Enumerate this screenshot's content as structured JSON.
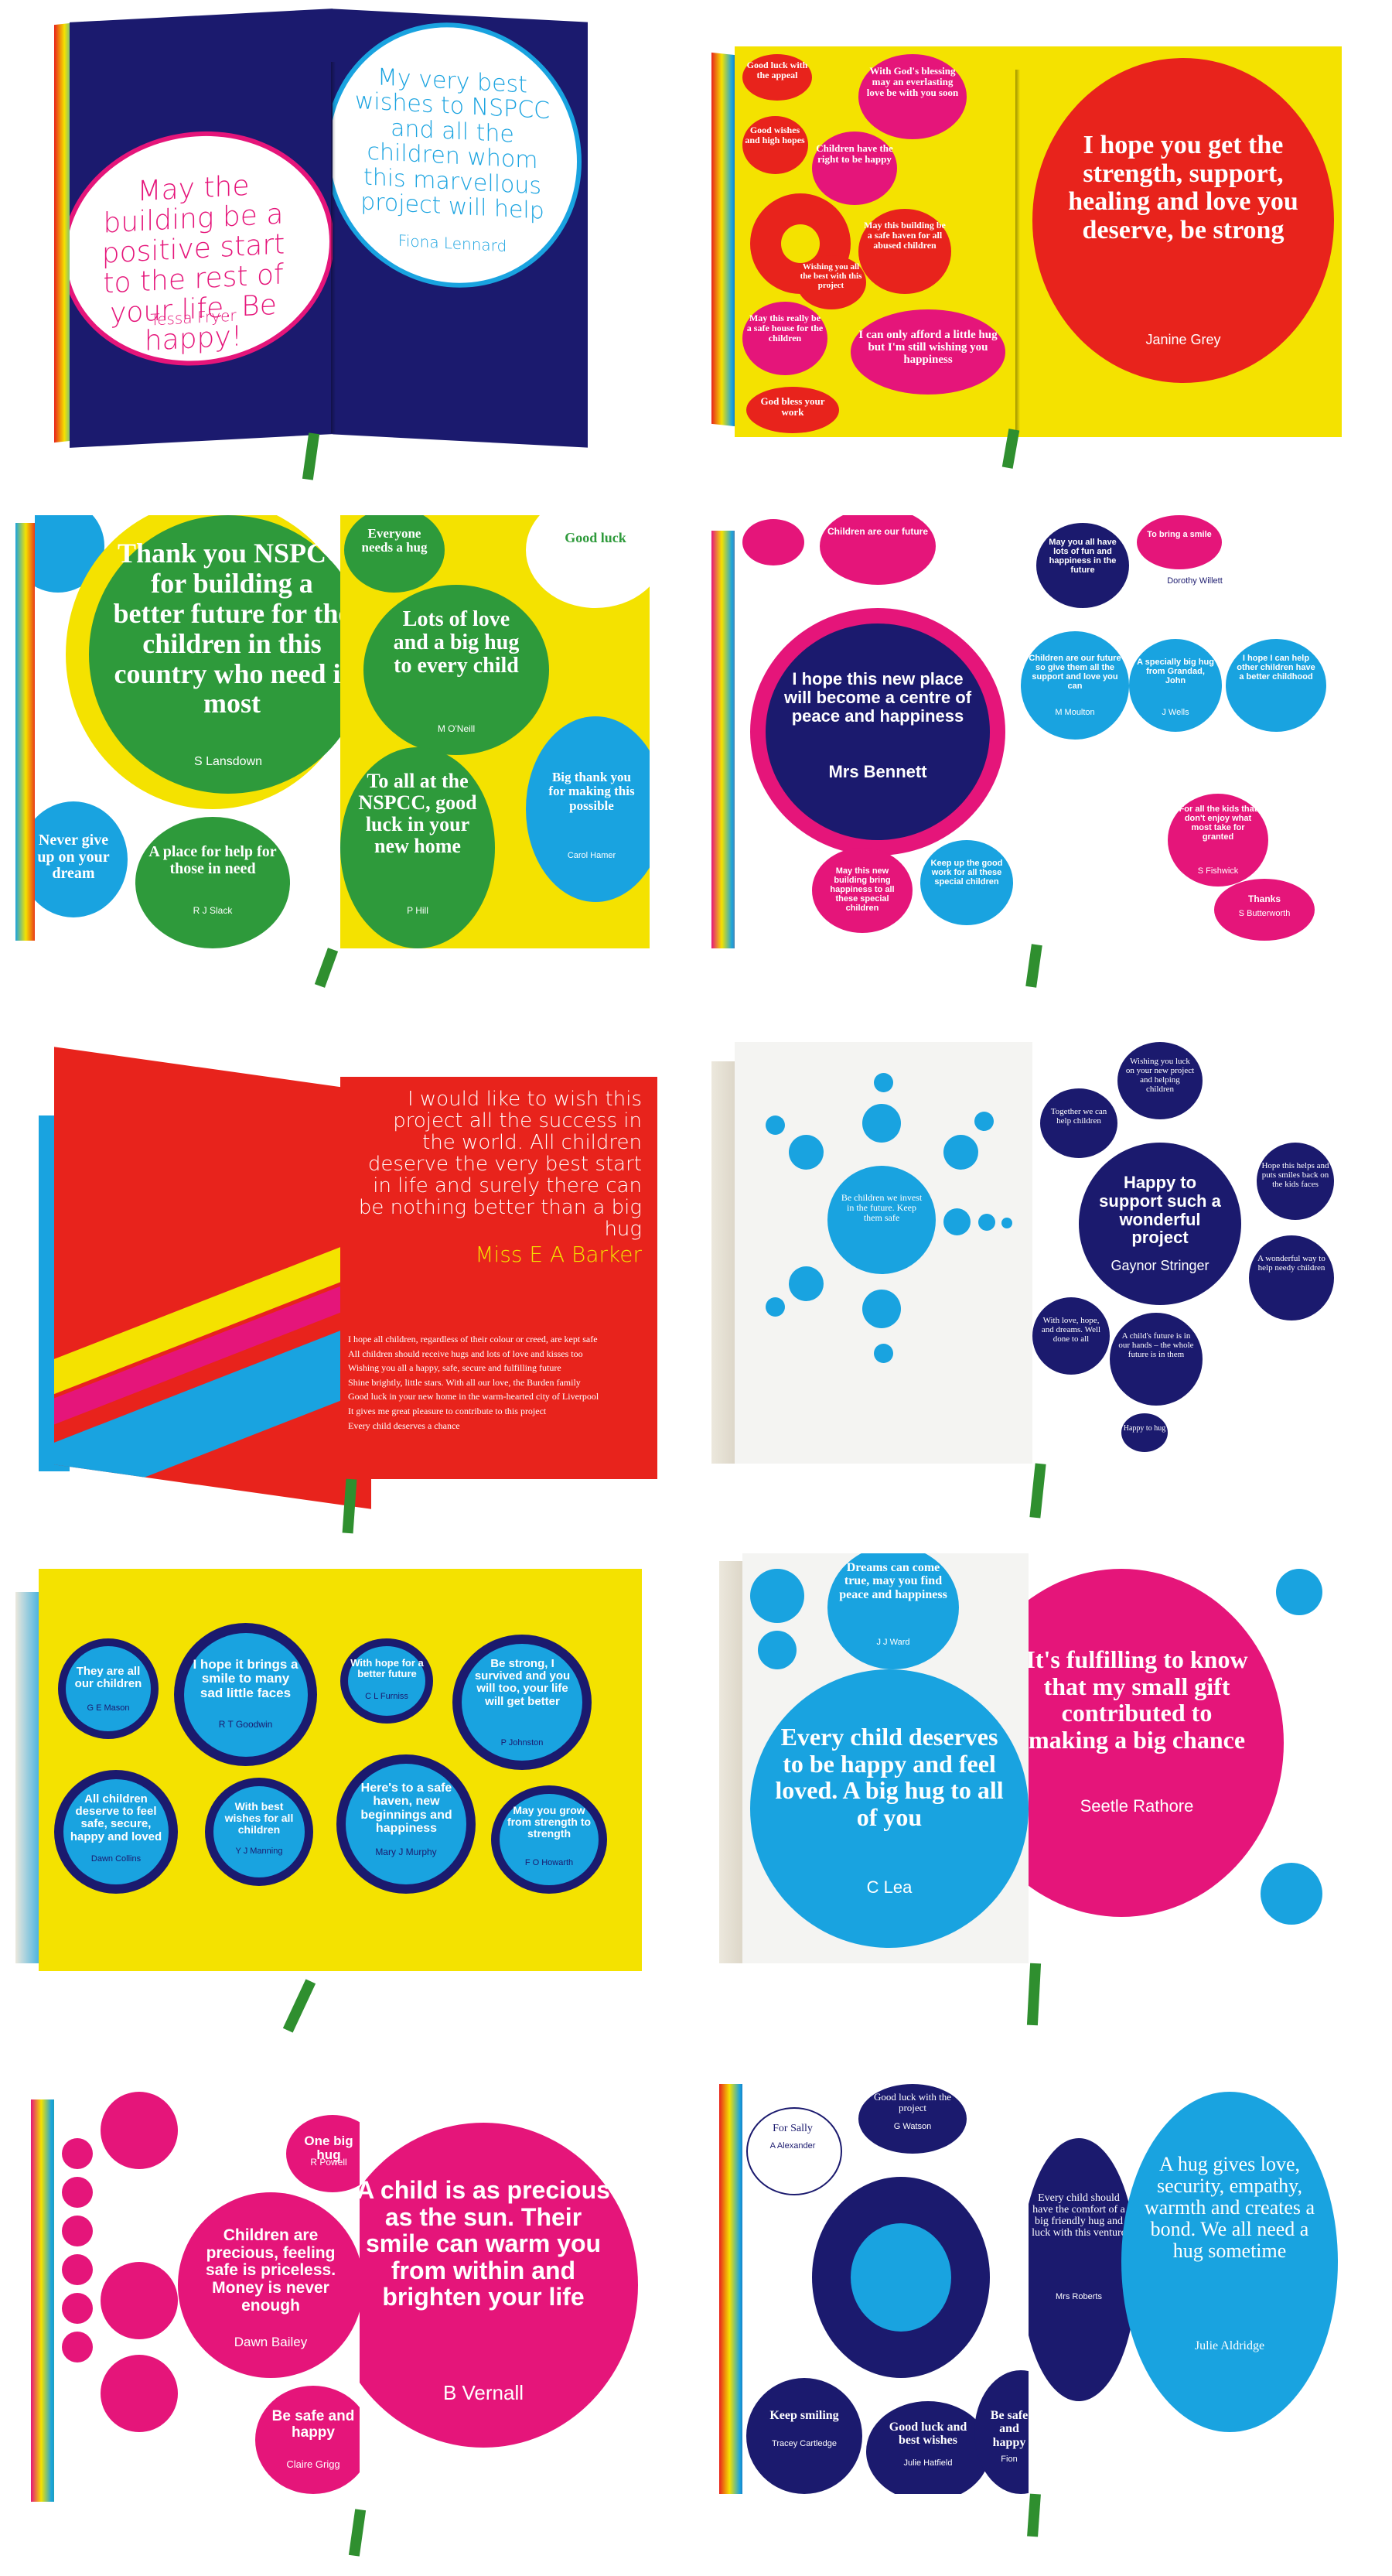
{
  "spreads": [
    {
      "left": {
        "quote": "May the building be a positive start to the rest of your life. Be happy!",
        "author": "Tessa Fryer"
      },
      "right": {
        "quote": "My very best wishes to NSPCC and all the children whom this marvellous project will help",
        "author": "Fiona Lennard"
      }
    },
    {
      "left": {
        "quotes": [
          "Good luck with the appeal",
          "With God's blessing may an everlasting love be with you soon",
          "Good wishes and high hopes",
          "Children have the right to be happy",
          "May this building be a safe haven for all abused children",
          "May this really be a safe house for the children",
          "Wishing you all the best with this project",
          "I can only afford a little hug but I'm still wishing you happiness",
          "God bless your work"
        ]
      },
      "right": {
        "quote": "I hope you get the strength, support, healing and love you deserve, be strong",
        "author": "Janine Grey"
      }
    },
    {
      "left": {
        "quote": "Thank you NSPCC for building a better future for the children in this country who need it most",
        "author": "S Lansdown",
        "small": [
          "Never give up on your dream",
          "A place for help for those in need"
        ],
        "small_author": "R J Slack"
      },
      "right": {
        "quotes": [
          "Everyone needs a hug",
          "Good luck",
          "Lots of love and a big hug to every child",
          "To all at the NSPCC, good luck in your new home",
          "Big thank you for making this possible"
        ],
        "authors": [
          "M O'Neill",
          "P Hill",
          "Carol Hamer"
        ]
      }
    },
    {
      "left": {
        "quote": "I hope this new place will become a centre of peace and happiness",
        "author": "Mrs Bennett",
        "small": [
          "Children are our future",
          "May this new building bring happiness to all these special children",
          "Keep up the good work for all these special children"
        ]
      },
      "right": {
        "small": [
          "May you all have lots of fun and happiness in the future",
          "To bring a smile",
          "Children are our future so give them all the support and love you can",
          "A specially big hug from Grandad, John",
          "I hope I can help other children have a better childhood",
          "For all the kids that don't enjoy what most take for granted",
          "Thanks"
        ],
        "authors": [
          "Dorothy Willett",
          "M Moulton",
          "J Wells",
          "S Fishwick",
          "S Butterworth"
        ]
      }
    },
    {
      "left": {
        "lines": [
          "I hope all children, regardless of their colour or creed, are kept safe",
          "All children should receive hugs and lots of love and kisses too",
          "Wishing you all a happy, safe, secure and fulfilling future",
          "Shine brightly, little stars. With all our love, the Burden family",
          "Good luck in your new home in the warm-hearted city of Liverpool",
          "It gives me great pleasure to contribute to this project",
          "Every child deserves a chance"
        ]
      },
      "right": {
        "quote": "I would like to wish this project all the success in the world. All children deserve the very best start in life and surely there can be nothing better than a big hug",
        "author": "Miss E A Barker"
      }
    },
    {
      "left": {
        "quote": "Be children we invest in the future. Keep them safe"
      },
      "right": {
        "quote": "Happy to support such a wonderful project",
        "author": "Gaynor Stringer",
        "small": [
          "Wishing you luck on your new project and helping children",
          "Together we can help children",
          "A wonderful way to help needy children",
          "A child's future is in our hands – the whole future is in them",
          "With love, hope, and dreams. Well done to all",
          "Hope this helps and puts smiles back on the kids faces",
          "Happy to hug"
        ]
      }
    },
    {
      "left": {
        "quotes": [
          "They are all our children",
          "I hope it brings a smile to many sad little faces",
          "All children deserve to feel safe, secure, happy and loved",
          "With best wishes for all children"
        ],
        "authors": [
          "G E Mason",
          "R T Goodwin",
          "Dawn Collins",
          "Y J Manning"
        ]
      },
      "right": {
        "quotes": [
          "With hope for a better future",
          "Be strong, I survived and you will too, your life will get better",
          "Here's to a safe haven, new beginnings and happiness",
          "May you grow from strength to strength"
        ],
        "authors": [
          "C L Furniss",
          "P Johnston",
          "Mary J Murphy",
          "F O Howarth"
        ]
      }
    },
    {
      "left": {
        "quote": "Every child deserves to be happy and feel loved. A big hug to all of you",
        "author": "C Lea",
        "small": [
          "Dreams can come true, may you find peace and happiness"
        ],
        "small_author": "J J Ward"
      },
      "right": {
        "quote": "It's fulfilling to know that my small gift contributed to making a big chance",
        "author": "Seetle Rathore"
      }
    },
    {
      "left": {
        "quote": "Children are precious, feeling safe is priceless. Money is never enough",
        "author": "Dawn Bailey",
        "small": [
          "Be safe and happy"
        ],
        "small_author": "Claire Grigg"
      },
      "right": {
        "quote": "A child is as precious as the sun. Their smile can warm you from within and brighten your life",
        "author": "B Vernall",
        "small": [
          "One big hug"
        ],
        "small_author": "R Powell"
      }
    },
    {
      "left": {
        "small": [
          "For Sally",
          "Good luck with the project",
          "Every child should have the comfort of a big friendly hug and luck with this venture",
          "Keep smiling",
          "Good luck and best wishes",
          "Be safe and happy"
        ],
        "authors": [
          "A Alexander",
          "G Watson",
          "Mrs Roberts",
          "Tracey Cartledge",
          "Julie Hatfield",
          "Fion"
        ]
      },
      "right": {
        "quote": "A hug gives love, security, empathy, warmth and creates a bond. We all need a hug sometime",
        "author": "Julie Aldridge"
      }
    }
  ],
  "colors": {
    "navy": "#1b1a6e",
    "blue": "#19a3e0",
    "magenta": "#e5157a",
    "red": "#e8231c",
    "yellow": "#f4e200",
    "green": "#2e9a3b",
    "white": "#ffffff"
  }
}
